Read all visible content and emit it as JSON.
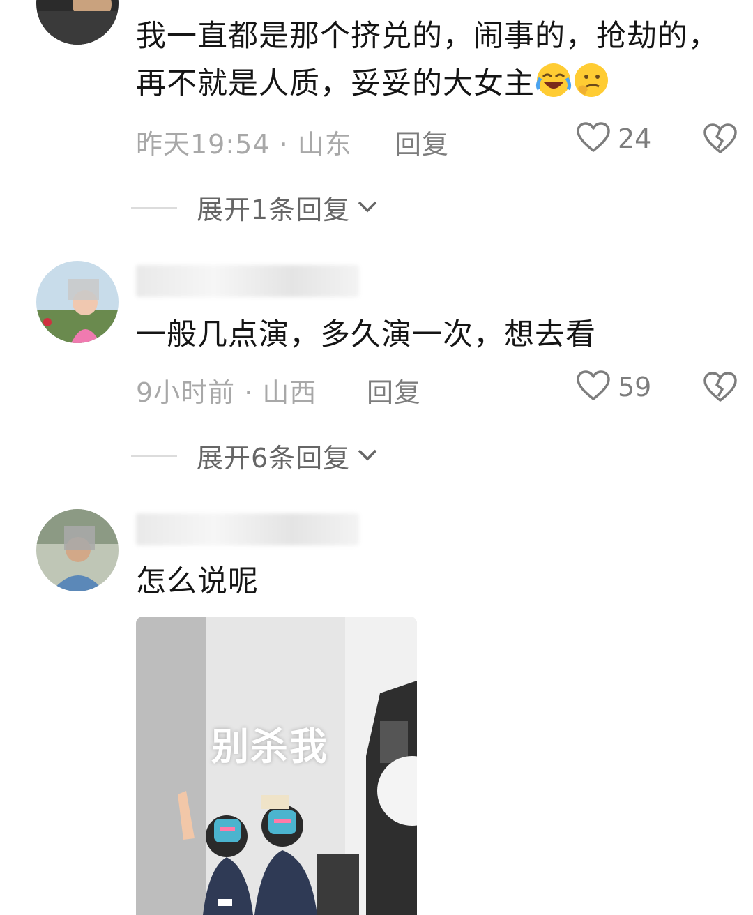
{
  "comments": [
    {
      "text": "我一直都是那个挤兑的，闹事的，抢劫的，再不就是人质，妥妥的大女主",
      "time_location": "昨天19:54 · 山东",
      "reply_label": "回复",
      "likes": "24",
      "expand_label": "展开1条回复",
      "emojis": [
        "laughing-crying-emoji",
        "thinking-emoji"
      ]
    },
    {
      "text": "一般几点演，多久演一次，想去看",
      "time_location": "9小时前 · 山西",
      "reply_label": "回复",
      "likes": "59",
      "expand_label": "展开6条回复"
    },
    {
      "text": "怎么说呢",
      "image_caption": "别杀我"
    }
  ],
  "colors": {
    "text": "#151515",
    "meta": "#a8a8a8",
    "action": "#7d7d7d"
  }
}
